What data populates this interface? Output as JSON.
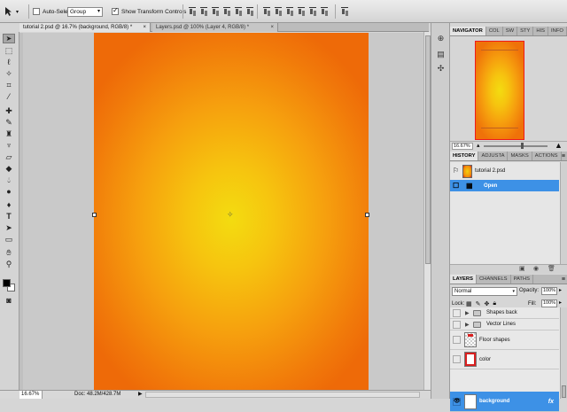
{
  "option_bar": {
    "auto_select_label": "Auto-Select:",
    "auto_select_checked": false,
    "auto_select_mode": "Group",
    "transform_controls_label": "Show Transform Controls",
    "transform_controls_checked": true
  },
  "document_tabs": [
    {
      "label": "tutorial 2.psd @ 16.7% (background, RGB/8) *",
      "active": true
    },
    {
      "label": "Layers.psd @ 100% (Layer 4, RGB/8) *",
      "active": false
    }
  ],
  "status_bar": {
    "zoom": "16.67%",
    "doc_info": "Doc: 48.2M/428.7M"
  },
  "navigator": {
    "tabs": [
      "NAVIGATOR",
      "COL",
      "SW",
      "STY",
      "HIS",
      "INFO"
    ],
    "zoom": "16.67%"
  },
  "history": {
    "tabs": [
      "HISTORY",
      "ADJUSTA",
      "MASKS",
      "ACTIONS"
    ],
    "snapshot_label": "tutorial 2.psd",
    "items": [
      {
        "label": "Open",
        "selected": true
      }
    ]
  },
  "layers": {
    "tabs": [
      "LAYERS",
      "CHANNELS",
      "PATHS"
    ],
    "blend_mode": "Normal",
    "opacity_label": "Opacity:",
    "opacity": "100%",
    "lock_label": "Lock:",
    "fill_label": "Fill:",
    "fill": "100%",
    "items": [
      {
        "name": "Shapes back",
        "kind": "group",
        "selected": false
      },
      {
        "name": "Vector Lines",
        "kind": "group",
        "selected": false
      },
      {
        "name": "Floor shapes",
        "kind": "layer",
        "selected": false
      },
      {
        "name": "color",
        "kind": "layer",
        "selected": false
      },
      {
        "name": "background",
        "kind": "layer",
        "selected": true,
        "fx": "fx"
      }
    ]
  },
  "colors": {
    "selection_blue": "#3d91e6",
    "canvas_center": "#f3dc10",
    "canvas_edge": "#ee6a08",
    "foreground": "#000000",
    "background": "#ffffff"
  }
}
